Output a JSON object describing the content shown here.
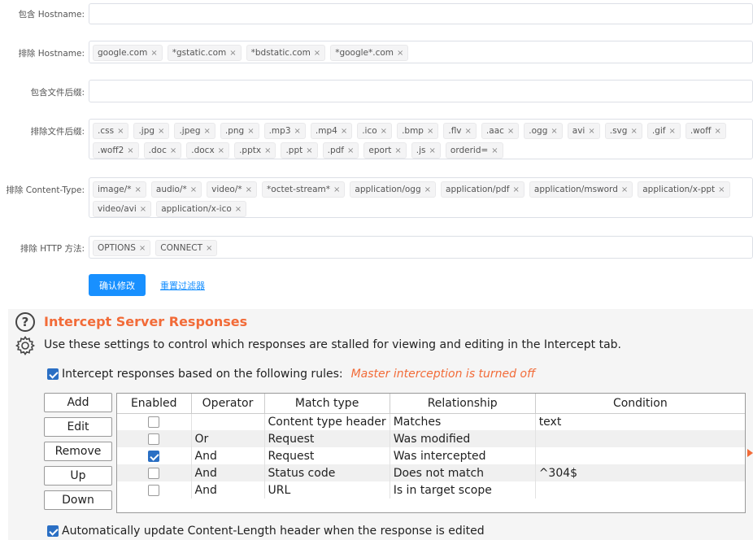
{
  "filters": {
    "include_hostname": {
      "label": "包含 Hostname:",
      "tags": []
    },
    "exclude_hostname": {
      "label": "排除 Hostname:",
      "tags": [
        "google.com",
        "*gstatic.com",
        "*bdstatic.com",
        "*google*.com"
      ]
    },
    "include_ext": {
      "label": "包含文件后缀:",
      "tags": []
    },
    "exclude_ext": {
      "label": "排除文件后缀:",
      "tags": [
        ".css",
        ".jpg",
        ".jpeg",
        ".png",
        ".mp3",
        ".mp4",
        ".ico",
        ".bmp",
        ".flv",
        ".aac",
        ".ogg",
        "avi",
        ".svg",
        ".gif",
        ".woff",
        ".woff2",
        ".doc",
        ".docx",
        ".pptx",
        ".ppt",
        ".pdf",
        "eport",
        ".js",
        "orderid="
      ]
    },
    "exclude_content_type": {
      "label": "排除 Content-Type:",
      "tags": [
        "image/*",
        "audio/*",
        "video/*",
        "*octet-stream*",
        "application/ogg",
        "application/pdf",
        "application/msword",
        "application/x-ppt",
        "video/avi",
        "application/x-ico"
      ]
    },
    "exclude_http_method": {
      "label": "排除 HTTP 方法:",
      "tags": [
        "OPTIONS",
        "CONNECT"
      ]
    },
    "confirm_label": "确认修改",
    "reset_label": "重置过滤器"
  },
  "burp": {
    "title": "Intercept Server Responses",
    "description": "Use these settings to control which responses are stalled for viewing and editing in the Intercept tab.",
    "rules_checkbox": {
      "label": "Intercept responses based on the following rules:",
      "checked": true
    },
    "master_warning": "Master interception is turned off",
    "buttons": [
      "Add",
      "Edit",
      "Remove",
      "Up",
      "Down"
    ],
    "columns": [
      "Enabled",
      "Operator",
      "Match type",
      "Relationship",
      "Condition"
    ],
    "rows": [
      {
        "enabled": false,
        "operator": "",
        "match_type": "Content type header",
        "relationship": "Matches",
        "condition": "text"
      },
      {
        "enabled": false,
        "operator": "Or",
        "match_type": "Request",
        "relationship": "Was modified",
        "condition": ""
      },
      {
        "enabled": true,
        "operator": "And",
        "match_type": "Request",
        "relationship": "Was intercepted",
        "condition": ""
      },
      {
        "enabled": false,
        "operator": "And",
        "match_type": "Status code",
        "relationship": "Does not match",
        "condition": "^304$"
      },
      {
        "enabled": false,
        "operator": "And",
        "match_type": "URL",
        "relationship": "Is in target scope",
        "condition": ""
      }
    ],
    "auto_update": {
      "label": "Automatically update Content-Length header when the response is edited",
      "checked": true
    },
    "colors": {
      "accent": "#f26b38",
      "primary": "#1890ff",
      "checkbox": "#2a6fc4"
    }
  }
}
